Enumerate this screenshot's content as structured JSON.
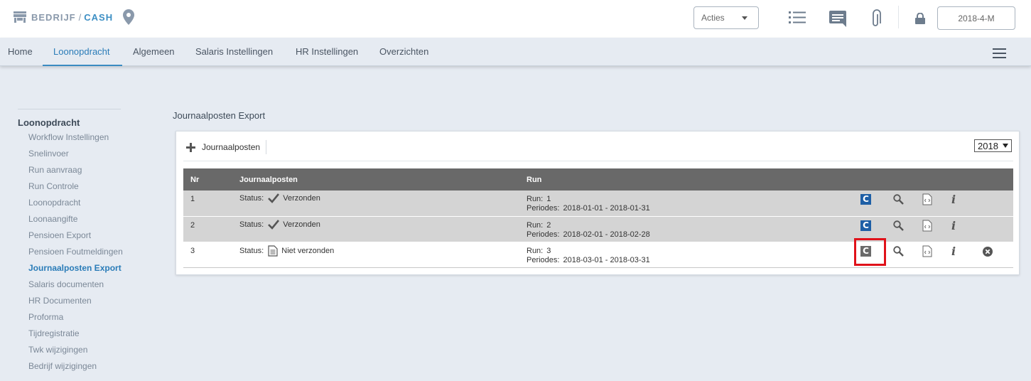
{
  "header": {
    "company": "BEDRIJF",
    "separator": "/",
    "client": "CASH",
    "actions_label": "Acties",
    "period_label": "2018-4-M",
    "icons": [
      "store-icon",
      "location-pin-icon",
      "list-icon",
      "chat-icon",
      "paperclip-icon",
      "lock-icon"
    ]
  },
  "nav": {
    "tabs": [
      {
        "label": "Home"
      },
      {
        "label": "Loonopdracht"
      },
      {
        "label": "Algemeen"
      },
      {
        "label": "Salaris Instellingen"
      },
      {
        "label": "HR Instellingen"
      },
      {
        "label": "Overzichten"
      }
    ],
    "active_tab": "Loonopdracht"
  },
  "sidebar": {
    "title": "Loonopdracht",
    "items": [
      {
        "label": "Workflow Instellingen"
      },
      {
        "label": "Snelinvoer"
      },
      {
        "label": "Run aanvraag"
      },
      {
        "label": "Run Controle"
      },
      {
        "label": "Loonopdracht"
      },
      {
        "label": "Loonaangifte"
      },
      {
        "label": "Pensioen Export"
      },
      {
        "label": "Pensioen Foutmeldingen"
      },
      {
        "label": "Journaalposten Export"
      },
      {
        "label": "Salaris documenten"
      },
      {
        "label": "HR Documenten"
      },
      {
        "label": "Proforma"
      },
      {
        "label": "Tijdregistratie"
      },
      {
        "label": "Twk wijzigingen"
      },
      {
        "label": "Bedrijf wijzigingen"
      }
    ],
    "active_item": "Journaalposten Export"
  },
  "main": {
    "title": "Journaalposten Export",
    "add_label": "Journaalposten",
    "year": "2018",
    "table": {
      "columns": [
        "Nr",
        "Journaalposten",
        "Run"
      ],
      "rows": [
        {
          "nr": "1",
          "status_label": "Status:",
          "status": "Verzonden",
          "status_icon": "check-icon",
          "run_label": "Run:",
          "run": "1",
          "periods_label": "Periodes:",
          "periods": "2018-01-01 - 2018-01-31"
        },
        {
          "nr": "2",
          "status_label": "Status:",
          "status": "Verzonden",
          "status_icon": "check-icon",
          "run_label": "Run:",
          "run": "2",
          "periods_label": "Periodes:",
          "periods": "2018-02-01 - 2018-02-28"
        },
        {
          "nr": "3",
          "status_label": "Status:",
          "status": "Niet verzonden",
          "status_icon": "document-icon",
          "run_label": "Run:",
          "run": "3",
          "periods_label": "Periodes:",
          "periods": "2018-03-01 - 2018-03-31"
        }
      ]
    }
  },
  "colors": {
    "accent": "#2a7cb8",
    "table_header": "#696969",
    "highlight": "#e0121a",
    "c_badge": "#1e5fa6"
  }
}
